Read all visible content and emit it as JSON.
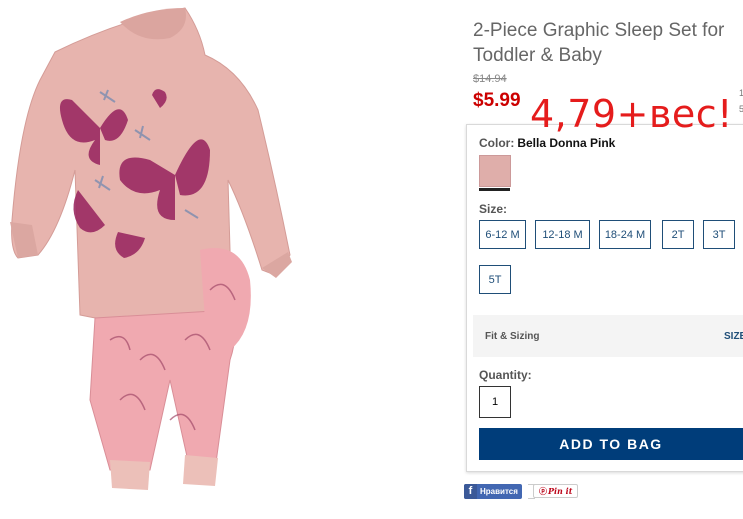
{
  "product": {
    "title": "2-Piece Graphic Sleep Set for Toddler & Baby",
    "original_price": "$14.94",
    "sale_price": "$5.99",
    "annotation": "4,79+вес!"
  },
  "edge_fragments": [
    "1",
    "5"
  ],
  "color": {
    "label": "Color:",
    "value": "Bella Donna Pink",
    "swatch_hex": "#dfaeaa"
  },
  "size": {
    "label": "Size:",
    "options": [
      "6-12 M",
      "12-18 M",
      "18-24 M",
      "2T",
      "3T",
      "5T"
    ]
  },
  "fit": {
    "label": "Fit & Sizing",
    "link_label": "SIZE"
  },
  "quantity": {
    "label": "Quantity:",
    "value": "1"
  },
  "add_to_bag_label": "ADD TO BAG",
  "social": {
    "facebook_label": "Нравится",
    "pinterest_label": "Pin it"
  },
  "colors": {
    "accent": "#1f4e78",
    "add_button": "#003d7a",
    "sale": "#cc0000",
    "annotation": "#e51c1c"
  }
}
